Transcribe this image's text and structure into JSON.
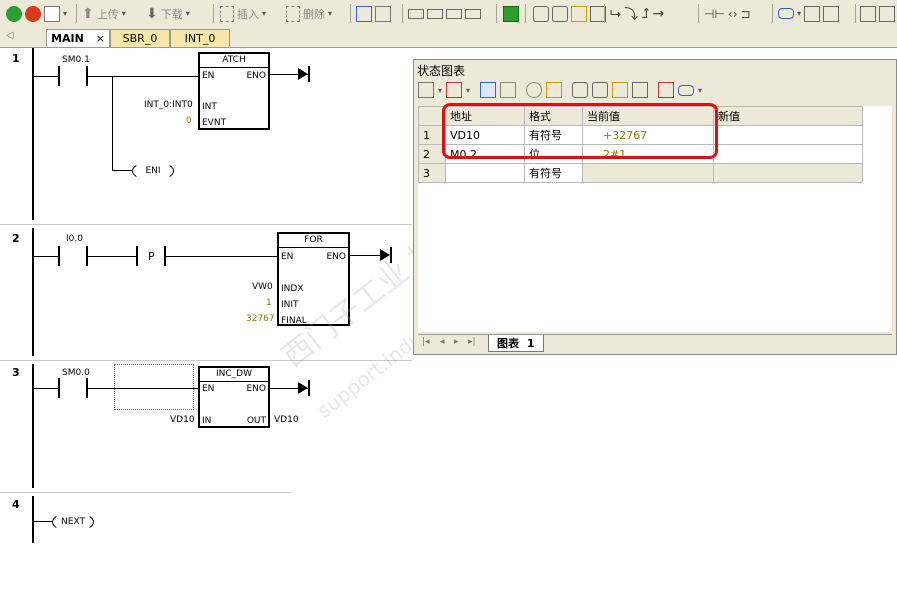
{
  "toolbar": {
    "upload_label": "上传",
    "download_label": "下载",
    "insert_label": "插入",
    "delete_label": "删除",
    "colors": {
      "run": "#2e9e2e",
      "stop": "#d83a1a"
    }
  },
  "tabs": [
    {
      "label": "MAIN",
      "close": "×"
    },
    {
      "label": "SBR_0"
    },
    {
      "label": "INT_0"
    }
  ],
  "ladder": {
    "networks": [
      {
        "number": "1",
        "contact": "SM0.1",
        "box_title": "ATCH",
        "en": "EN",
        "eno": "ENO",
        "pin_int": "INT",
        "pin_evnt": "EVNT",
        "int_value": "INT_0:INT0",
        "evnt_value": "0",
        "coil": "ENI"
      },
      {
        "number": "2",
        "contact": "I0.0",
        "p_label": "P",
        "box_title": "FOR",
        "en": "EN",
        "eno": "ENO",
        "pin_indx": "INDX",
        "pin_init": "INIT",
        "pin_final": "FINAL",
        "indx_value": "VW0",
        "init_value": "1",
        "final_value": "32767"
      },
      {
        "number": "3",
        "contact": "SM0.0",
        "box_title": "INC_DW",
        "en": "EN",
        "eno": "ENO",
        "pin_in": "IN",
        "pin_out": "OUT",
        "in_value": "VD10",
        "out_value": "VD10"
      },
      {
        "number": "4",
        "coil": "NEXT"
      }
    ]
  },
  "status_chart": {
    "title": "状态图表",
    "columns": [
      "地址",
      "格式",
      "当前值",
      "新值"
    ],
    "rows": [
      {
        "num": "1",
        "address": "VD10",
        "format": "有符号",
        "current": "+32767",
        "new": ""
      },
      {
        "num": "2",
        "address": "M0.2",
        "format": "位",
        "current": "2#1",
        "new": ""
      },
      {
        "num": "3",
        "address": "",
        "format": "有符号",
        "current": "",
        "new": ""
      }
    ],
    "sheet_tab_label": "图表",
    "sheet_tab_number": "1",
    "colors": {
      "highlight": "#e01010",
      "value_text": "#8a7a00"
    }
  },
  "watermark": {
    "line1": "西门子工业  技术论坛",
    "line2": "support.industry.siemens.com/cs"
  }
}
